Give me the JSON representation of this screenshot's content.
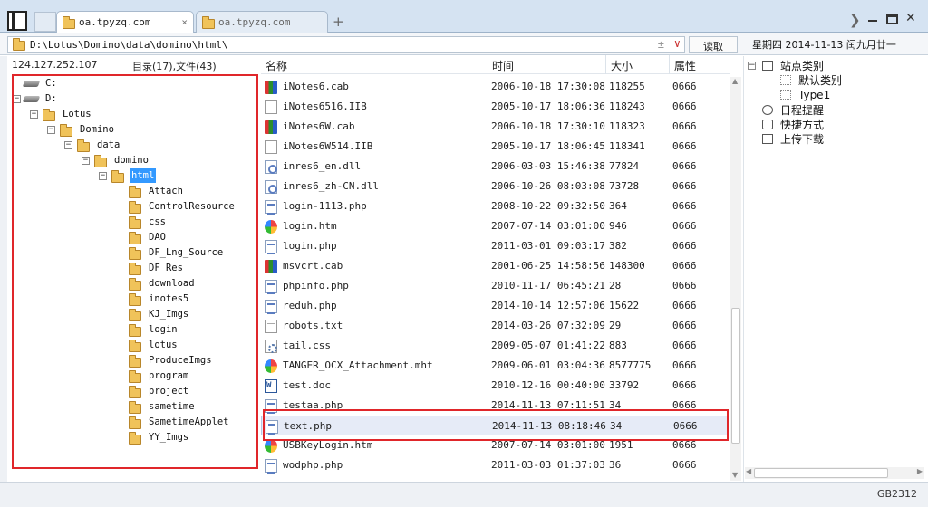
{
  "tabs": [
    {
      "title": "oa.tpyzq.com",
      "active": true
    },
    {
      "title": "oa.tpyzq.com",
      "active": false
    }
  ],
  "tab_close": "×",
  "new_tab": "+",
  "address": {
    "path": "D:\\Lotus\\Domino\\data\\domino\\html\\",
    "plus_minus": "±",
    "dropdown": "∨",
    "read_button": "读取"
  },
  "date_text": "星期四 2014-11-13 闰九月廿一",
  "left_pane": {
    "ip": "124.127.252.107",
    "counts": "目录(17),文件(43)",
    "tree": [
      {
        "label": "C:",
        "type": "drive",
        "level": 0,
        "expander": ""
      },
      {
        "label": "D:",
        "type": "drive",
        "level": 0,
        "expander": "−"
      },
      {
        "label": "Lotus",
        "type": "folder",
        "level": 1,
        "expander": "−"
      },
      {
        "label": "Domino",
        "type": "folder",
        "level": 2,
        "expander": "−"
      },
      {
        "label": "data",
        "type": "folder",
        "level": 3,
        "expander": "−"
      },
      {
        "label": "domino",
        "type": "folder",
        "level": 4,
        "expander": "−"
      },
      {
        "label": "html",
        "type": "folder",
        "level": 5,
        "expander": "−",
        "selected": true
      },
      {
        "label": "Attach",
        "type": "folder",
        "level": 6,
        "expander": ""
      },
      {
        "label": "ControlResource",
        "type": "folder",
        "level": 6,
        "expander": ""
      },
      {
        "label": "css",
        "type": "folder",
        "level": 6,
        "expander": ""
      },
      {
        "label": "DAO",
        "type": "folder",
        "level": 6,
        "expander": ""
      },
      {
        "label": "DF_Lng_Source",
        "type": "folder",
        "level": 6,
        "expander": ""
      },
      {
        "label": "DF_Res",
        "type": "folder",
        "level": 6,
        "expander": ""
      },
      {
        "label": "download",
        "type": "folder",
        "level": 6,
        "expander": ""
      },
      {
        "label": "inotes5",
        "type": "folder",
        "level": 6,
        "expander": ""
      },
      {
        "label": "KJ_Imgs",
        "type": "folder",
        "level": 6,
        "expander": ""
      },
      {
        "label": "login",
        "type": "folder",
        "level": 6,
        "expander": ""
      },
      {
        "label": "lotus",
        "type": "folder",
        "level": 6,
        "expander": ""
      },
      {
        "label": "ProduceImgs",
        "type": "folder",
        "level": 6,
        "expander": ""
      },
      {
        "label": "program",
        "type": "folder",
        "level": 6,
        "expander": ""
      },
      {
        "label": "project",
        "type": "folder",
        "level": 6,
        "expander": ""
      },
      {
        "label": "sametime",
        "type": "folder",
        "level": 6,
        "expander": ""
      },
      {
        "label": "SametimeApplet",
        "type": "folder",
        "level": 6,
        "expander": ""
      },
      {
        "label": "YY_Imgs",
        "type": "folder",
        "level": 6,
        "expander": ""
      }
    ]
  },
  "file_list": {
    "columns": [
      "名称",
      "时间",
      "大小",
      "属性"
    ],
    "rows": [
      {
        "name": "iNotes6.cab",
        "time": "2006-10-18 17:30:08",
        "size": "118255",
        "attr": "0666",
        "icon": "cab-icon"
      },
      {
        "name": "iNotes6516.IIB",
        "time": "2005-10-17 18:06:36",
        "size": "118243",
        "attr": "0666",
        "icon": "doc-icon"
      },
      {
        "name": "iNotes6W.cab",
        "time": "2006-10-18 17:30:10",
        "size": "118323",
        "attr": "0666",
        "icon": "cab-icon"
      },
      {
        "name": "iNotes6W514.IIB",
        "time": "2005-10-17 18:06:45",
        "size": "118341",
        "attr": "0666",
        "icon": "doc-icon"
      },
      {
        "name": "inres6_en.dll",
        "time": "2006-03-03 15:46:38",
        "size": "77824",
        "attr": "0666",
        "icon": "dll-icon"
      },
      {
        "name": "inres6_zh-CN.dll",
        "time": "2006-10-26 08:03:08",
        "size": "73728",
        "attr": "0666",
        "icon": "dll-icon"
      },
      {
        "name": "login-1113.php",
        "time": "2008-10-22 09:32:50",
        "size": "364",
        "attr": "0666",
        "icon": "php-icon"
      },
      {
        "name": "login.htm",
        "time": "2007-07-14 03:01:00",
        "size": "946",
        "attr": "0666",
        "icon": "htm-icon"
      },
      {
        "name": "login.php",
        "time": "2011-03-01 09:03:17",
        "size": "382",
        "attr": "0666",
        "icon": "php-icon"
      },
      {
        "name": "msvcrt.cab",
        "time": "2001-06-25 14:58:56",
        "size": "148300",
        "attr": "0666",
        "icon": "cab-icon"
      },
      {
        "name": "phpinfo.php",
        "time": "2010-11-17 06:45:21",
        "size": "28",
        "attr": "0666",
        "icon": "php-icon"
      },
      {
        "name": "reduh.php",
        "time": "2014-10-14 12:57:06",
        "size": "15622",
        "attr": "0666",
        "icon": "php-icon"
      },
      {
        "name": "robots.txt",
        "time": "2014-03-26 07:32:09",
        "size": "29",
        "attr": "0666",
        "icon": "txt-icon"
      },
      {
        "name": "tail.css",
        "time": "2009-05-07 01:41:22",
        "size": "883",
        "attr": "0666",
        "icon": "css-icon"
      },
      {
        "name": "TANGER_OCX_Attachment.mht",
        "time": "2009-06-01 03:04:36",
        "size": "8577775",
        "attr": "0666",
        "icon": "htm-icon"
      },
      {
        "name": "test.doc",
        "time": "2010-12-16 00:40:00",
        "size": "33792",
        "attr": "0666",
        "icon": "word-icon"
      },
      {
        "name": "testaa.php",
        "time": "2014-11-13 07:11:51",
        "size": "34",
        "attr": "0666",
        "icon": "php-icon"
      },
      {
        "name": "text.php",
        "time": "2014-11-13 08:18:46",
        "size": "34",
        "attr": "0666",
        "icon": "php-icon",
        "selected": true
      },
      {
        "name": "USBKeyLogin.htm",
        "time": "2007-07-14 03:01:00",
        "size": "1951",
        "attr": "0666",
        "icon": "htm-icon"
      },
      {
        "name": "wodphp.php",
        "time": "2011-03-03 01:37:03",
        "size": "36",
        "attr": "0666",
        "icon": "php-icon"
      }
    ]
  },
  "right_pane": {
    "items": [
      {
        "label": "站点类别",
        "level": 0,
        "expander": "−",
        "icon": "box"
      },
      {
        "label": "默认类别",
        "level": 1,
        "expander": "",
        "icon": "dot"
      },
      {
        "label": "Type1",
        "level": 1,
        "expander": "",
        "icon": "dot"
      },
      {
        "label": "日程提醒",
        "level": 0,
        "expander": "",
        "icon": "clock"
      },
      {
        "label": "快捷方式",
        "level": 0,
        "expander": "",
        "icon": "hand"
      },
      {
        "label": "上传下载",
        "level": 0,
        "expander": "",
        "icon": "box"
      }
    ]
  },
  "status": {
    "encoding": "GB2312"
  },
  "colors": {
    "highlight_box": "#e0262a",
    "selection": "#3399ff"
  }
}
